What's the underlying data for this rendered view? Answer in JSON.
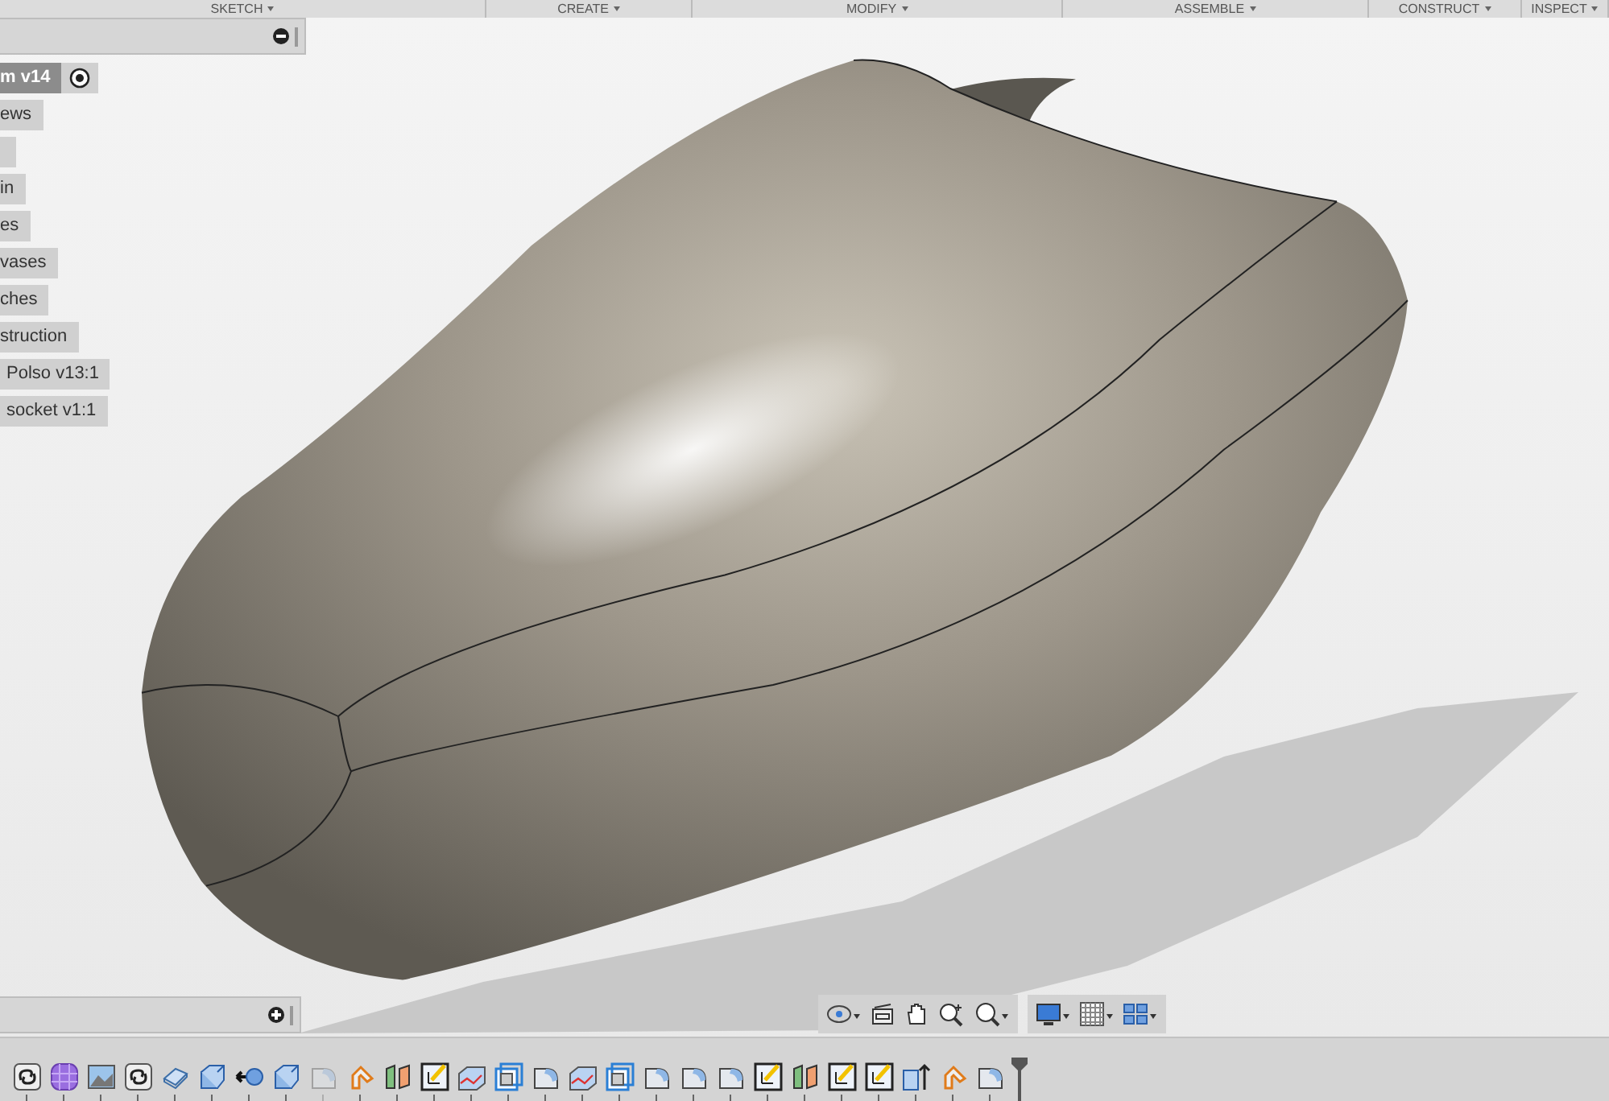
{
  "toolbar": {
    "menus": [
      {
        "label": "SKETCH"
      },
      {
        "label": "CREATE"
      },
      {
        "label": "MODIFY"
      },
      {
        "label": "ASSEMBLE"
      },
      {
        "label": "CONSTRUCT"
      },
      {
        "label": "INSPECT"
      }
    ]
  },
  "browser": {
    "items": [
      {
        "label": "m v14",
        "selected": true,
        "active": true
      },
      {
        "label": "ews",
        "selected": false,
        "active": false
      },
      {
        "selected": false,
        "active": false
      },
      {
        "label": "in",
        "selected": false,
        "active": false
      },
      {
        "label": "es",
        "selected": false,
        "active": false
      },
      {
        "label": "vases",
        "selected": false,
        "active": false
      },
      {
        "label": "ches",
        "selected": false,
        "active": false
      },
      {
        "label": "struction",
        "selected": false,
        "active": false
      },
      {
        "label": "Polso v13:1",
        "selected": false,
        "active": false
      },
      {
        "label": "socket v1:1",
        "selected": false,
        "active": false
      }
    ]
  },
  "timeline": {
    "features": [
      {
        "kind": "link",
        "disabled": false
      },
      {
        "kind": "form",
        "disabled": false
      },
      {
        "kind": "canvas",
        "disabled": false
      },
      {
        "kind": "link",
        "disabled": false
      },
      {
        "kind": "split",
        "disabled": false
      },
      {
        "kind": "extrude",
        "disabled": false
      },
      {
        "kind": "joint",
        "disabled": false
      },
      {
        "kind": "extrude",
        "disabled": false
      },
      {
        "kind": "fillet",
        "disabled": true
      },
      {
        "kind": "sweep",
        "disabled": false
      },
      {
        "kind": "splitface",
        "disabled": false
      },
      {
        "kind": "sketch",
        "disabled": false
      },
      {
        "kind": "patch",
        "disabled": false
      },
      {
        "kind": "shell",
        "disabled": false
      },
      {
        "kind": "fillet",
        "disabled": false
      },
      {
        "kind": "patch",
        "disabled": false
      },
      {
        "kind": "shell",
        "disabled": false
      },
      {
        "kind": "fillet",
        "disabled": false
      },
      {
        "kind": "fillet",
        "disabled": false
      },
      {
        "kind": "fillet",
        "disabled": false
      },
      {
        "kind": "sketch",
        "disabled": false
      },
      {
        "kind": "splitface",
        "disabled": false
      },
      {
        "kind": "sketch",
        "disabled": false
      },
      {
        "kind": "sketch",
        "disabled": false
      },
      {
        "kind": "presspull",
        "disabled": false
      },
      {
        "kind": "sweep",
        "disabled": false
      },
      {
        "kind": "fillet",
        "disabled": false
      }
    ]
  }
}
